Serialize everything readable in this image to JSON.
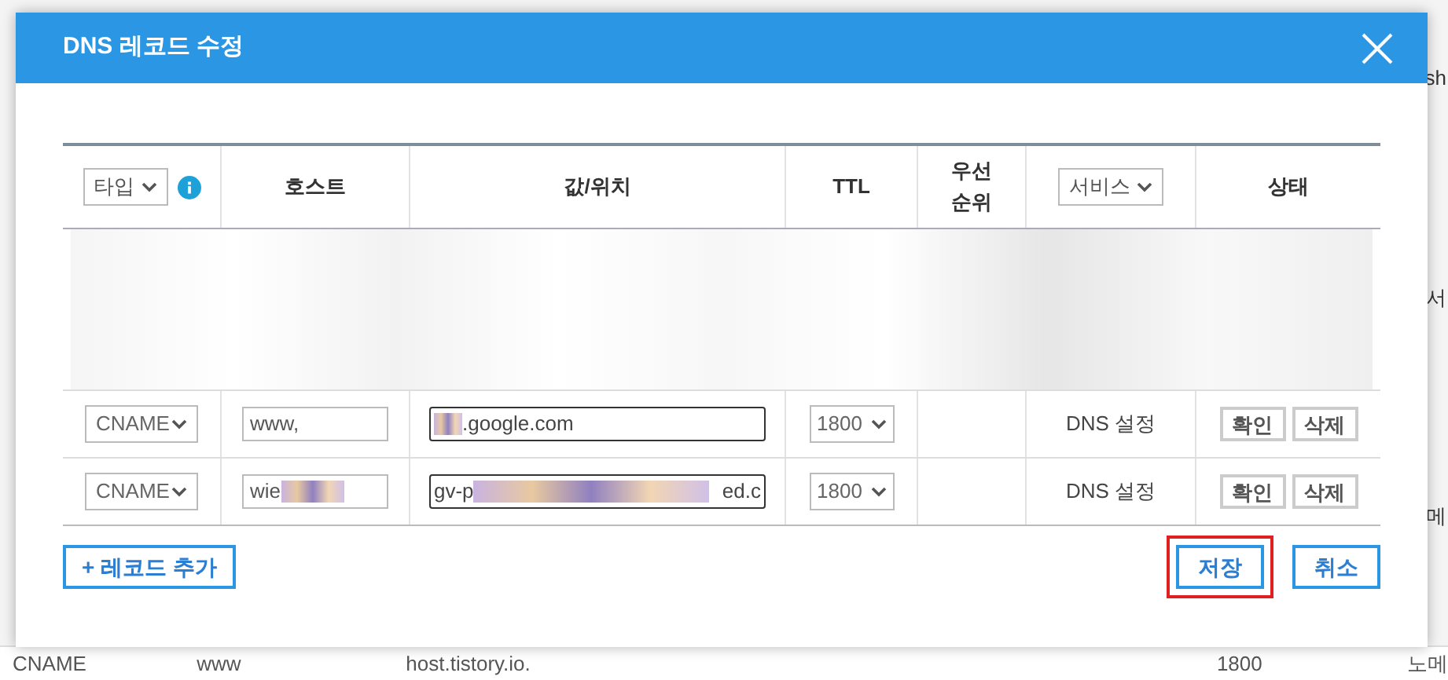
{
  "background": {
    "edge_texts": [
      "sh",
      "서",
      "메"
    ],
    "row": [
      "CNAME",
      "www",
      "host.tistory.io.",
      "1800",
      "노메"
    ]
  },
  "dialog": {
    "title": "DNS 레코드 수정",
    "columns": [
      {
        "kind": "select",
        "label": "타입",
        "info": true
      },
      {
        "kind": "text",
        "label": "호스트"
      },
      {
        "kind": "text",
        "label": "값/위치"
      },
      {
        "kind": "text",
        "label": "TTL"
      },
      {
        "kind": "text",
        "label": "우선\n순위"
      },
      {
        "kind": "select",
        "label": "서비스",
        "info": false
      },
      {
        "kind": "text",
        "label": "상태"
      }
    ],
    "records": [
      {
        "type": "CNAME",
        "host": "www,",
        "host_redacted": false,
        "value_start": ".google.com",
        "value_redacted": true,
        "ttl": "1800",
        "service": "DNS 설정",
        "actions": [
          "확인",
          "삭제"
        ]
      },
      {
        "type": "CNAME",
        "host": "wie",
        "host_redacted": true,
        "value_start": "gv-p",
        "value_end": "ed.c",
        "value_redacted": true,
        "ttl": "1800",
        "service": "DNS 설정",
        "actions": [
          "확인",
          "삭제"
        ]
      }
    ],
    "add_button": "+ 레코드 추가",
    "buttons": [
      {
        "label": "저장",
        "highlighted": true
      },
      {
        "label": "취소",
        "highlighted": false
      }
    ]
  }
}
